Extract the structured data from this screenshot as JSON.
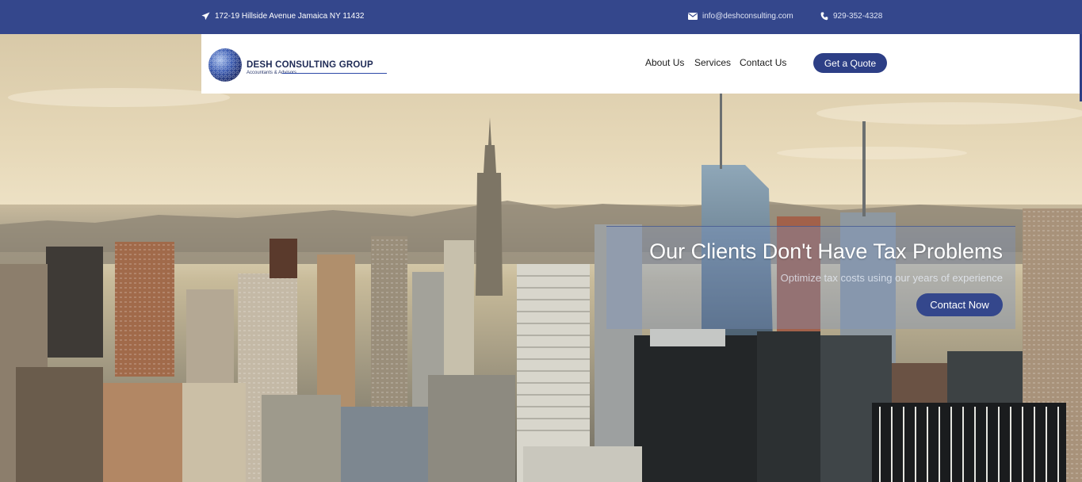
{
  "topbar": {
    "address": "172-19 Hillside Avenue Jamaica NY 11432",
    "email": "info@deshconsulting.com",
    "phone": "929-352-4328"
  },
  "logo": {
    "name_part1": "DESH CONSULTING",
    "name_part2": " GROUP",
    "tagline": "Accountants & Advisors"
  },
  "nav": {
    "items": [
      "About Us",
      "Services",
      "Contact Us"
    ],
    "cta": "Get a Quote"
  },
  "hero": {
    "title": "Our Clients Don't Have Tax Problems",
    "subtitle": "Optimize tax costs using our years of experience",
    "button": "Contact Now"
  },
  "colors": {
    "brand": "#34478c",
    "button": "#2d3f86"
  }
}
